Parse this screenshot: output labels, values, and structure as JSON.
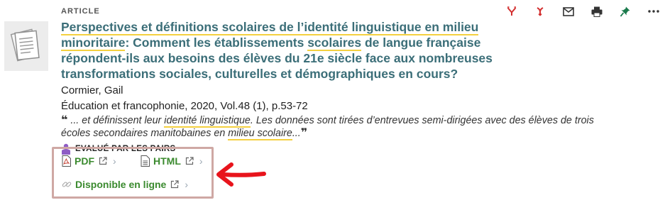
{
  "result": {
    "type_label": "ARTICLE",
    "title_parts": [
      {
        "text": "Perspectives et définitions scolaires de l’identité linguistique en milieu minoritaire",
        "hl": true
      },
      {
        "text": ":",
        "hl": false
      },
      {
        "text": " Comment les établissements ",
        "hl": false
      },
      {
        "text": "scolaires",
        "hl": true
      },
      {
        "text": " de langue française répondent-ils aux besoins des élèves du 21e siècle face aux nombreuses transformations sociales, culturelles et démographiques en cours?",
        "hl": false
      }
    ],
    "author": "Cormier, Gail",
    "source": "Éducation et francophonie, 2020, Vol.48 (1), p.53-72",
    "snippet": {
      "open_quote": "❝",
      "close_quote": "❞",
      "before": " ... et définissent leur ",
      "hl1": "identité linguistique",
      "middle": ". Les données sont tirées d’entrevues semi-dirigées avec des élèves de trois écoles secondaires manitobaines en ",
      "hl2": "milieu scolaire",
      "after": "..."
    },
    "peer_reviewed": "EVALUÉ PAR LES PAIRS",
    "links": {
      "pdf": "PDF",
      "html": "HTML",
      "online": "Disponible en ligne"
    }
  },
  "actions": [
    "cite-icon",
    "cite-alt-icon",
    "email-icon",
    "print-icon",
    "pin-icon",
    "more-icon"
  ],
  "colors": {
    "title": "#3b6e78",
    "highlight": "#f4d03f",
    "link_green": "#3a8a2e",
    "action_red": "#d32f2f",
    "box_border": "#cfa8a4",
    "arrow_red": "#e8141c"
  }
}
